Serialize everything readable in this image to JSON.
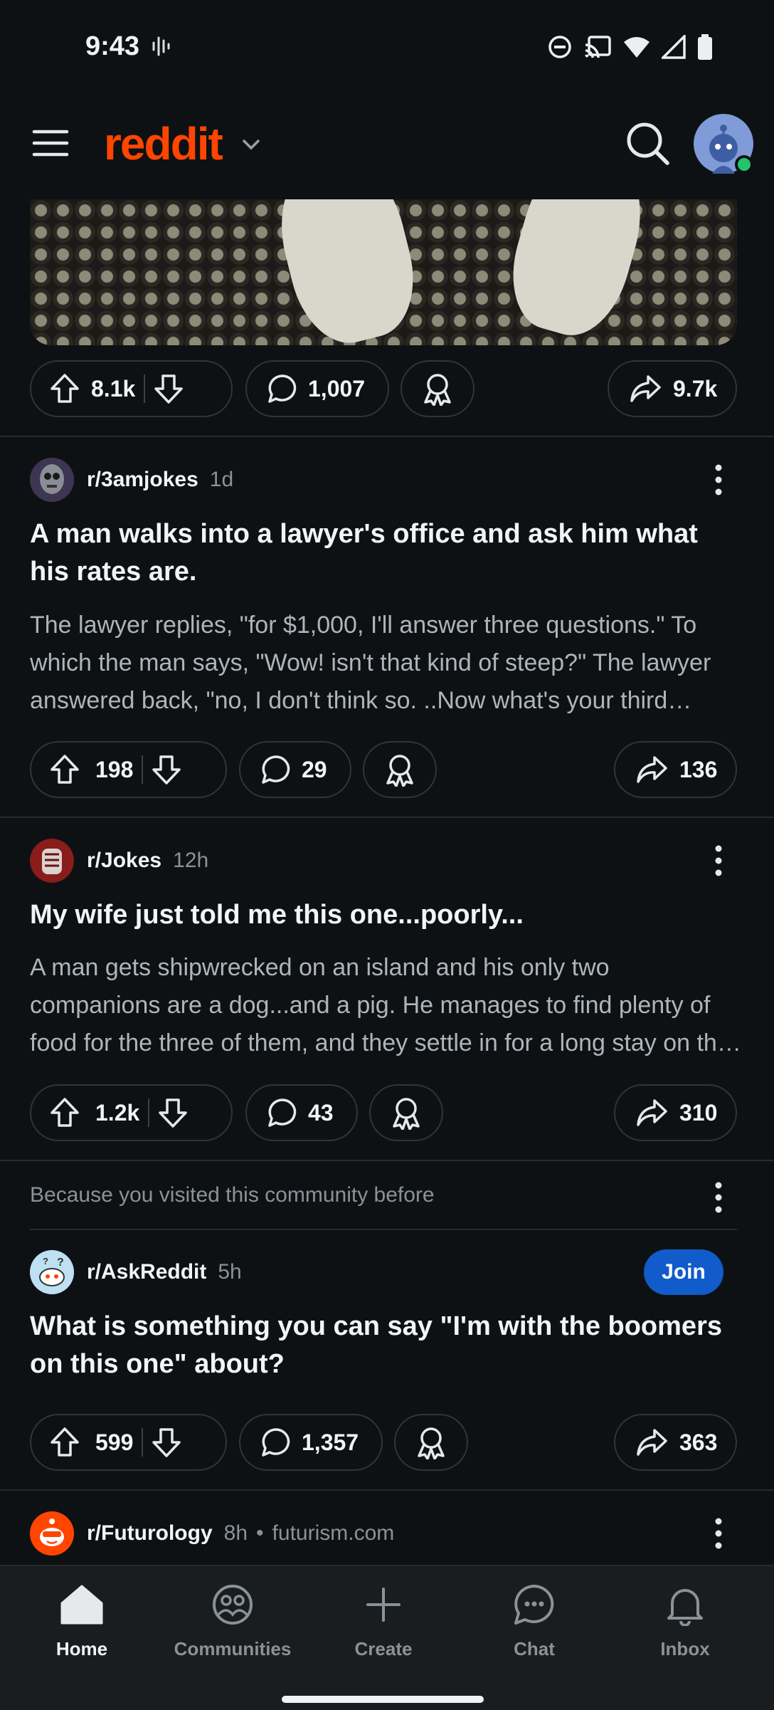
{
  "status_bar": {
    "time": "9:43"
  },
  "header": {
    "logo_text": "reddit"
  },
  "top_post": {
    "upvotes": "8.1k",
    "comments": "1,007",
    "shares": "9.7k"
  },
  "posts": [
    {
      "subreddit": "r/3amjokes",
      "age": "1d",
      "title": "A man walks into a lawyer's office and ask him what his rates are.",
      "body": "The lawyer replies, \"for $1,000, I'll answer three questions.\" To which the man says, \"Wow! isn't that kind of steep?\" The lawyer answered back, \"no, I don't think so. ..Now what's your third question?\"",
      "upvotes": "198",
      "comments": "29",
      "shares": "136"
    },
    {
      "subreddit": "r/Jokes",
      "age": "12h",
      "title": "My wife just told me this one...poorly...",
      "body": "A man gets shipwrecked on an island and his only two companions are a dog...and a pig. He manages to find plenty of food for the three of them, and they settle in for a long stay on the island.",
      "upvotes": "1.2k",
      "comments": "43",
      "shares": "310"
    },
    {
      "reason": "Because you visited this community before",
      "subreddit": "r/AskReddit",
      "age": "5h",
      "join_label": "Join",
      "title": "What is something you can say \"I'm with the boomers on this one\" about?",
      "upvotes": "599",
      "comments": "1,357",
      "shares": "363"
    },
    {
      "subreddit": "r/Futurology",
      "age": "8h",
      "domain": "futurism.com"
    }
  ],
  "bottom_nav": {
    "items": [
      {
        "label": "Home",
        "icon": "home-icon",
        "active": true
      },
      {
        "label": "Communities",
        "icon": "communities-icon"
      },
      {
        "label": "Create",
        "icon": "plus-icon"
      },
      {
        "label": "Chat",
        "icon": "chat-icon"
      },
      {
        "label": "Inbox",
        "icon": "bell-icon"
      }
    ]
  },
  "colors": {
    "brand": "#ff4500",
    "join": "#115bca",
    "background": "#0e1113"
  }
}
